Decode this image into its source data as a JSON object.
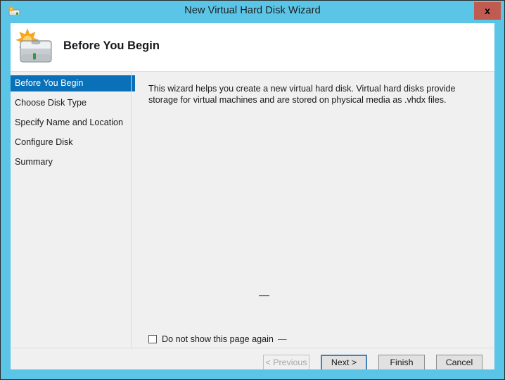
{
  "window": {
    "title": "New Virtual Hard Disk Wizard",
    "icon": "hard-disk-new-icon",
    "close_label": "x",
    "chrome_color": "#5bc5e8",
    "close_color": "#bf5b51"
  },
  "header": {
    "title": "Before You Begin",
    "icon": "hard-disk-new-large-icon"
  },
  "sidebar": {
    "selected_index": 0,
    "selected_color": "#0a71b9",
    "items": [
      {
        "label": "Before You Begin"
      },
      {
        "label": "Choose Disk Type"
      },
      {
        "label": "Specify Name and Location"
      },
      {
        "label": "Configure Disk"
      },
      {
        "label": "Summary"
      }
    ]
  },
  "content": {
    "paragraph": "This wizard helps you create a new virtual hard disk. Virtual hard disks provide storage for virtual machines and are stored on physical media as .vhdx files.",
    "checkbox": {
      "label": "Do not show this page again",
      "checked": false,
      "trailing_mark": "—"
    },
    "mid_mark": ""
  },
  "footer": {
    "buttons": [
      {
        "label": "< Previous",
        "state": "disabled"
      },
      {
        "label": "Next >",
        "state": "default"
      },
      {
        "label": "Finish",
        "state": "normal"
      },
      {
        "label": "Cancel",
        "state": "normal"
      }
    ]
  }
}
